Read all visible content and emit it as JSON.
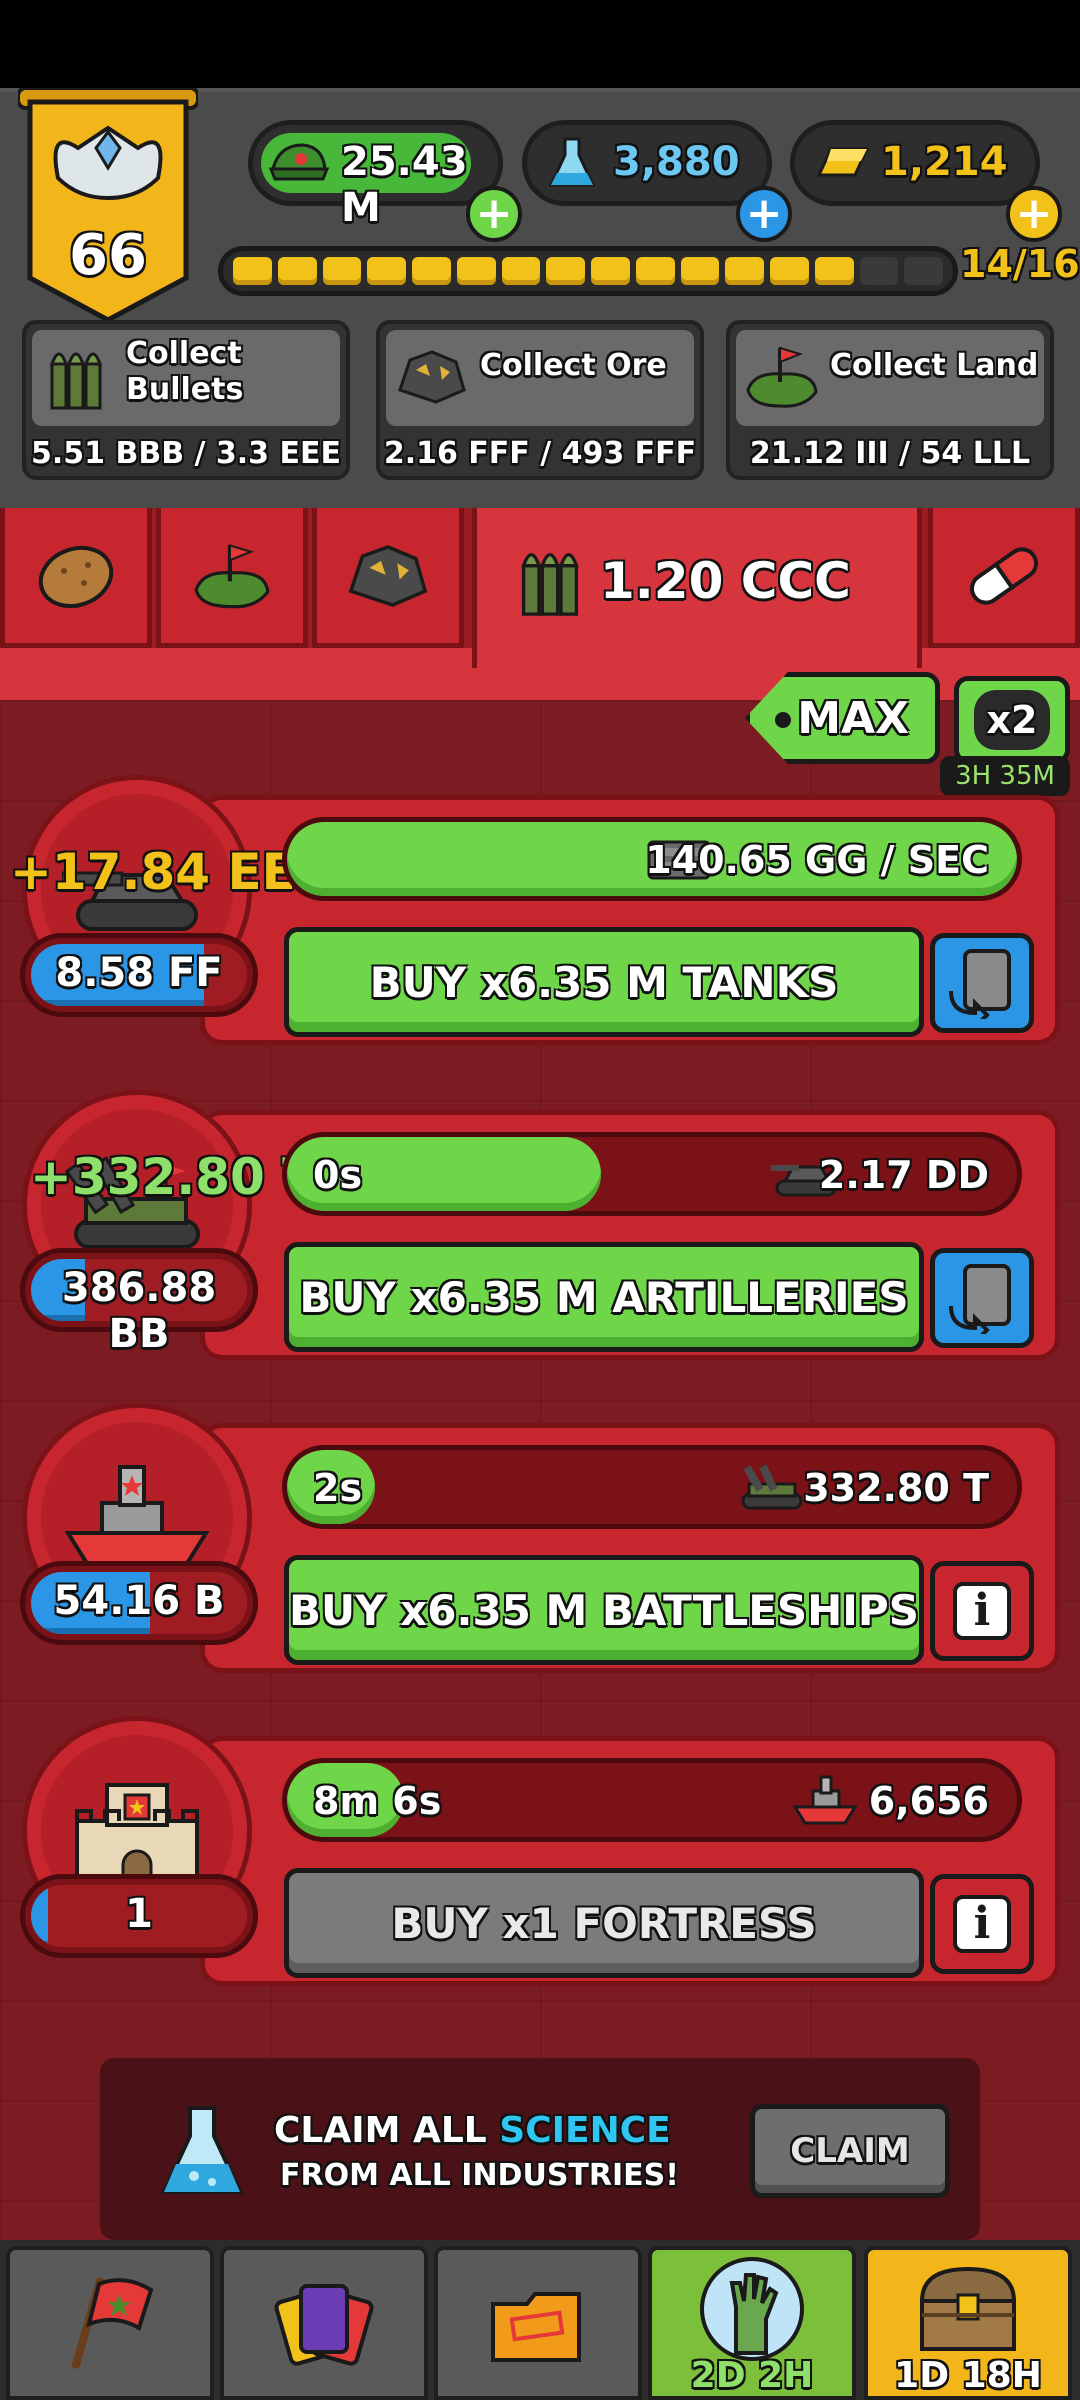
{
  "header": {
    "rank_level": "66",
    "resources": {
      "money": "25.43 M",
      "science": "3,880",
      "gold": "1,214"
    },
    "xp": {
      "label": "14/16",
      "filled": 14,
      "total": 16
    },
    "collect": [
      {
        "title_line1": "Collect",
        "title_line2": "Bullets",
        "value": "5.51 BBB / 3.3 EEE",
        "icon": "bullets-icon"
      },
      {
        "title_line1": "Collect Ore",
        "title_line2": "",
        "value": "2.16 FFF / 493 FFF",
        "icon": "ore-icon"
      },
      {
        "title_line1": "Collect Land",
        "title_line2": "",
        "value": "21.12 III / 54 LLL",
        "icon": "land-icon"
      }
    ]
  },
  "tabs": {
    "items": [
      "potato-icon",
      "land-icon",
      "ore-icon",
      "bullets-icon",
      "pill-icon"
    ],
    "active_amount": "1.20 CCC"
  },
  "controls": {
    "max_label": "MAX",
    "x2_label": "x2",
    "boost_timer": "3H 35M"
  },
  "units": [
    {
      "name": "tanks",
      "float_gain": "+17.84 EE",
      "count": "8.58 FF",
      "count_fill": 0.8,
      "progress_left": "",
      "progress_right": "140.65 GG / SEC",
      "progress_fill": 1.0,
      "buy_label": "BUY x6.35 M TANKS",
      "side": "swap"
    },
    {
      "name": "artilleries",
      "float_gain": "+332.80 T",
      "count": "386.88 BB",
      "count_fill": 0.25,
      "progress_left": "0s",
      "progress_right": "2.17 DD",
      "progress_fill": 0.43,
      "buy_label": "BUY x6.35 M ARTILLERIES",
      "side": "swap"
    },
    {
      "name": "battleships",
      "float_gain": "",
      "count": "54.16 B",
      "count_fill": 0.55,
      "progress_left": "2s",
      "progress_right": "332.80 T",
      "progress_fill": 0.09,
      "buy_label": "BUY x6.35 M BATTLESHIPS",
      "side": "info"
    },
    {
      "name": "fortress",
      "float_gain": "",
      "count": "1",
      "count_fill": 0.08,
      "progress_left": "8m 6s",
      "progress_right": "6,656",
      "progress_fill": 0.16,
      "buy_label": "BUY x1 FORTRESS",
      "side": "info"
    }
  ],
  "claim": {
    "line1_a": "CLAIM ALL",
    "line1_b": "SCIENCE",
    "line2": "FROM ALL INDUSTRIES!",
    "button": "CLAIM"
  },
  "bottom_nav": {
    "tabs": [
      "flag-icon",
      "cards-icon",
      "folder-icon",
      "zombie-hand-icon",
      "treasure-chest-icon"
    ],
    "event_timer": "2D 2H",
    "chest_timer": "1D 18H"
  },
  "colors": {
    "panel_red": "#c8262e",
    "bg_red": "#7c1b22",
    "green": "#6fd64a",
    "blue": "#2b95e6",
    "gold": "#f2c21a"
  }
}
